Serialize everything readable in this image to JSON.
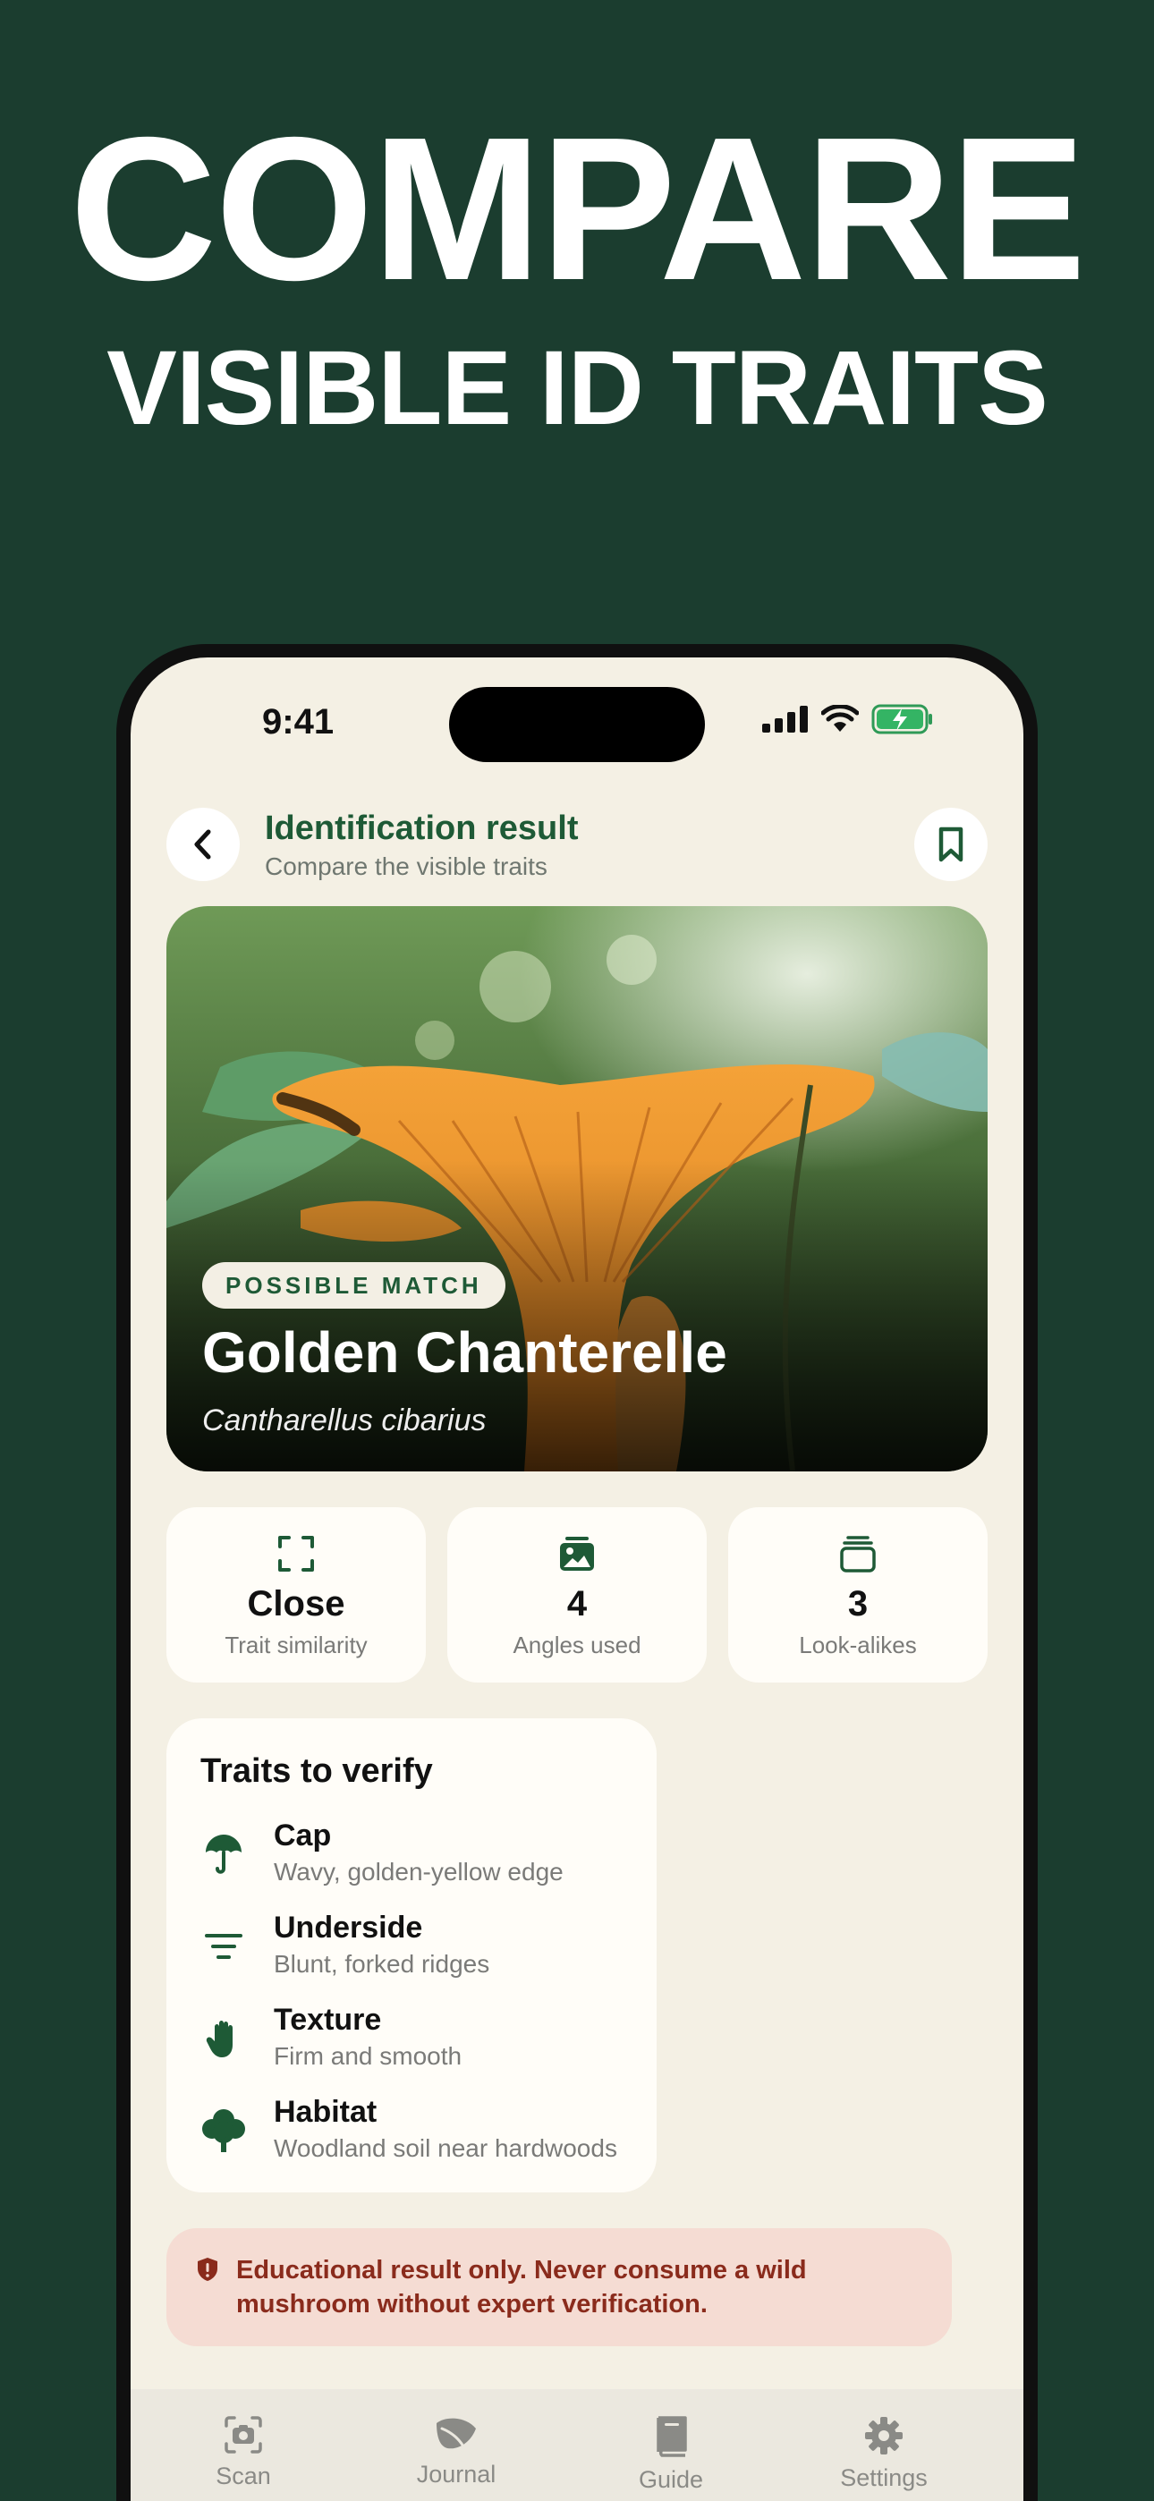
{
  "marketing": {
    "headline": "COMPARE",
    "subheadline": "VISIBLE ID TRAITS"
  },
  "status_bar": {
    "time": "9:41",
    "icons": [
      "cellular-signal-icon",
      "wifi-icon",
      "battery-charging-icon"
    ]
  },
  "nav": {
    "title": "Identification result",
    "subtitle": "Compare the visible traits",
    "back_icon": "chevron-left-icon",
    "bookmark_icon": "bookmark-icon"
  },
  "result": {
    "badge": "POSSIBLE MATCH",
    "common_name": "Golden Chanterelle",
    "scientific_name": "Cantharellus cibarius"
  },
  "stats": [
    {
      "value": "Close",
      "label": "Trait similarity",
      "icon": "focus-frame-icon"
    },
    {
      "value": "4",
      "label": "Angles used",
      "icon": "photo-stack-icon"
    },
    {
      "value": "3",
      "label": "Look-alikes",
      "icon": "cards-stack-icon"
    }
  ],
  "traits": {
    "title": "Traits to verify",
    "items": [
      {
        "name": "Cap",
        "description": "Wavy, golden-yellow edge",
        "icon": "umbrella-icon"
      },
      {
        "name": "Underside",
        "description": "Blunt, forked ridges",
        "icon": "lines-icon"
      },
      {
        "name": "Texture",
        "description": "Firm and smooth",
        "icon": "hand-icon"
      },
      {
        "name": "Habitat",
        "description": "Woodland soil near hardwoods",
        "icon": "tree-icon"
      }
    ]
  },
  "warning": {
    "text": "Educational result only. Never consume a wild mushroom without expert verification.",
    "icon": "alert-shield-icon"
  },
  "tabs": [
    {
      "label": "Scan",
      "icon": "camera-icon"
    },
    {
      "label": "Journal",
      "icon": "leaf-icon"
    },
    {
      "label": "Guide",
      "icon": "book-icon"
    },
    {
      "label": "Settings",
      "icon": "gear-icon"
    }
  ],
  "colors": {
    "background": "#1b3d2f",
    "screen": "#f4f0e4",
    "accent_green": "#1e5a36",
    "warning_bg": "#f5dcd3",
    "warning_text": "#8a2b1c",
    "mushroom_orange": "#e8952c"
  }
}
